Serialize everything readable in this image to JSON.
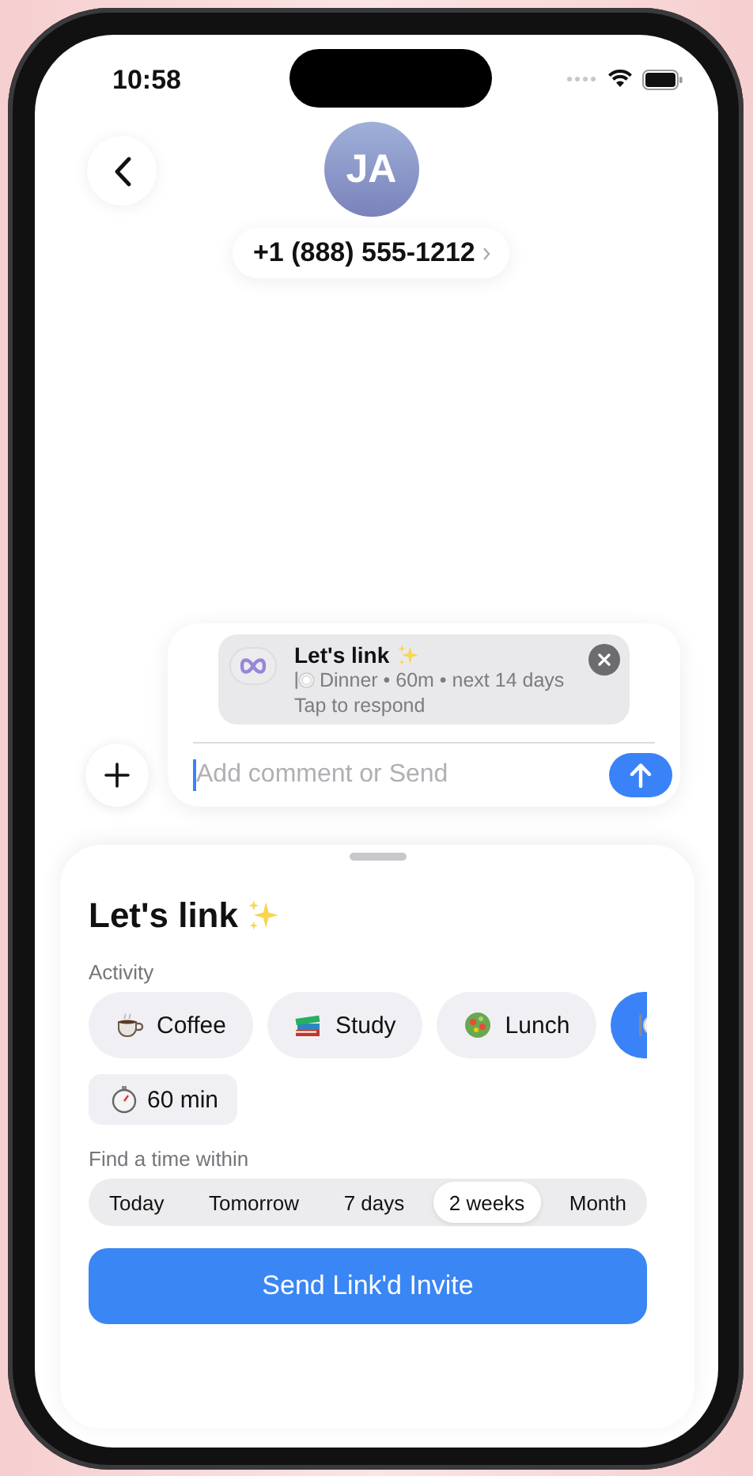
{
  "status_bar": {
    "time": "10:58"
  },
  "contact": {
    "initials": "JA",
    "phone": "+1 (888) 555-1212"
  },
  "compose": {
    "invite": {
      "title": "Let's link",
      "details": "Dinner • 60m • next 14 days",
      "hint": "Tap to respond"
    },
    "placeholder": "Add comment or Send"
  },
  "sheet": {
    "title": "Let's link",
    "activity_label": "Activity",
    "activities": [
      {
        "kind": "coffee",
        "label": "Coffee",
        "selected": false
      },
      {
        "kind": "study",
        "label": "Study",
        "selected": false
      },
      {
        "kind": "lunch",
        "label": "Lunch",
        "selected": false
      },
      {
        "kind": "dinner",
        "selected": true
      }
    ],
    "duration": {
      "label": "60 min"
    },
    "range_label": "Find a time within",
    "ranges": [
      {
        "label": "Today",
        "selected": false
      },
      {
        "label": "Tomorrow",
        "selected": false
      },
      {
        "label": "7 days",
        "selected": false
      },
      {
        "label": "2 weeks",
        "selected": true
      },
      {
        "label": "Month",
        "selected": false
      }
    ],
    "send_button": "Send Link'd Invite"
  }
}
